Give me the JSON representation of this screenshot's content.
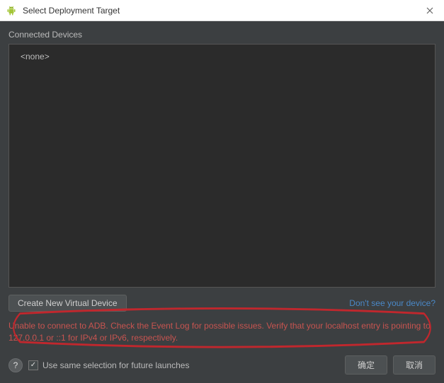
{
  "window": {
    "title": "Select Deployment Target"
  },
  "panel": {
    "connected_label": "Connected Devices",
    "none_text": "<none>"
  },
  "actions": {
    "create_vd": "Create New Virtual Device",
    "no_device_link": "Don't see your device?"
  },
  "error": {
    "message": "Unable to connect to ADB. Check the Event Log for possible issues. Verify that your localhost entry is pointing to 127.0.0.1 or ::1 for IPv4 or IPv6, respectively."
  },
  "footer": {
    "help_char": "?",
    "checkbox_checked": true,
    "checkbox_label": "Use same selection for future launches",
    "ok": "确定",
    "cancel": "取消"
  }
}
